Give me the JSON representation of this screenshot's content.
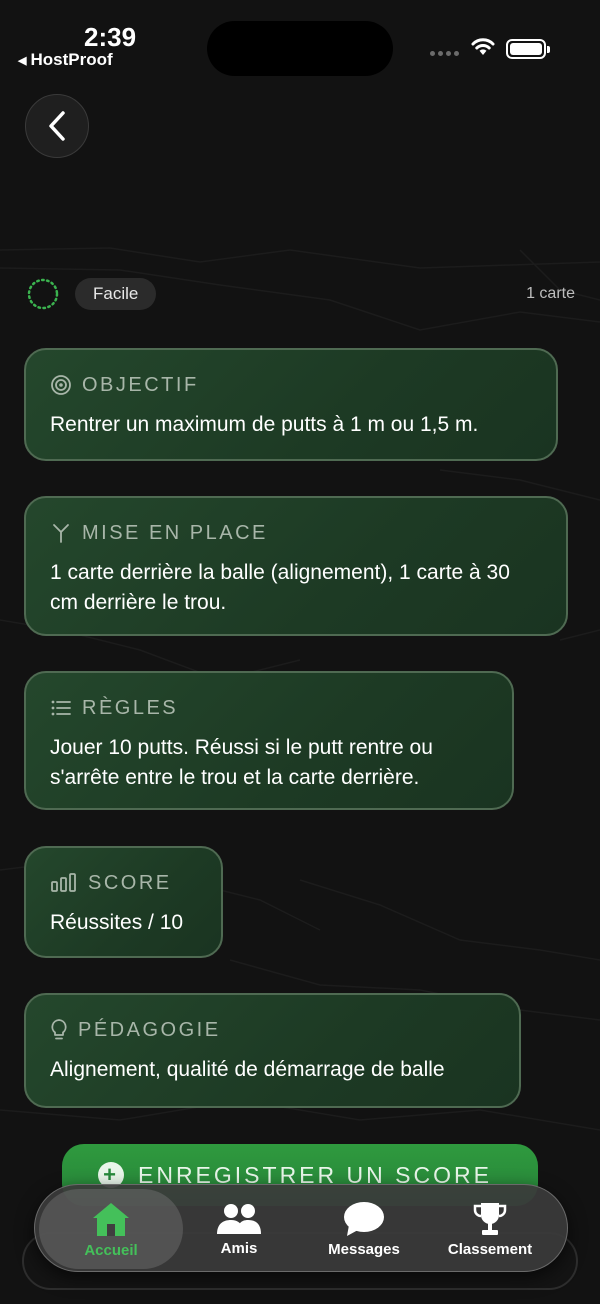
{
  "status_bar": {
    "time": "2:39",
    "back_app": "HostProof"
  },
  "meta": {
    "difficulty": "Facile",
    "card_count": "1 carte"
  },
  "sections": [
    {
      "icon": "target-icon",
      "title": "OBJECTIF",
      "text": "Rentrer un maximum de putts à 1 m ou 1,5 m."
    },
    {
      "icon": "fork-icon",
      "title": "MISE EN PLACE",
      "text": "1 carte derrière la balle (alignement), 1 carte à 30 cm derrière le trou."
    },
    {
      "icon": "list-icon",
      "title": "RÈGLES",
      "text": "Jouer 10 putts. Réussi si le putt rentre ou s'arrête entre le trou et la carte derrière."
    },
    {
      "icon": "bars-icon",
      "title": "SCORE",
      "text": "Réussites / 10"
    },
    {
      "icon": "lightbulb-icon",
      "title": "PÉDAGOGIE",
      "text": "Alignement, qualité de démarrage de balle"
    }
  ],
  "cta": {
    "label": "ENREGISTRER UN SCORE"
  },
  "tabs": [
    {
      "label": "Accueil",
      "icon": "home-icon",
      "active": true
    },
    {
      "label": "Amis",
      "icon": "friends-icon",
      "active": false
    },
    {
      "label": "Messages",
      "icon": "chat-icon",
      "active": false
    },
    {
      "label": "Classement",
      "icon": "trophy-icon",
      "active": false
    }
  ],
  "colors": {
    "background": "#121212",
    "card": "#1f3e27",
    "card_border": "#4f6a52",
    "accent": "#2f9a3e",
    "active_tab": "#44c05a"
  }
}
